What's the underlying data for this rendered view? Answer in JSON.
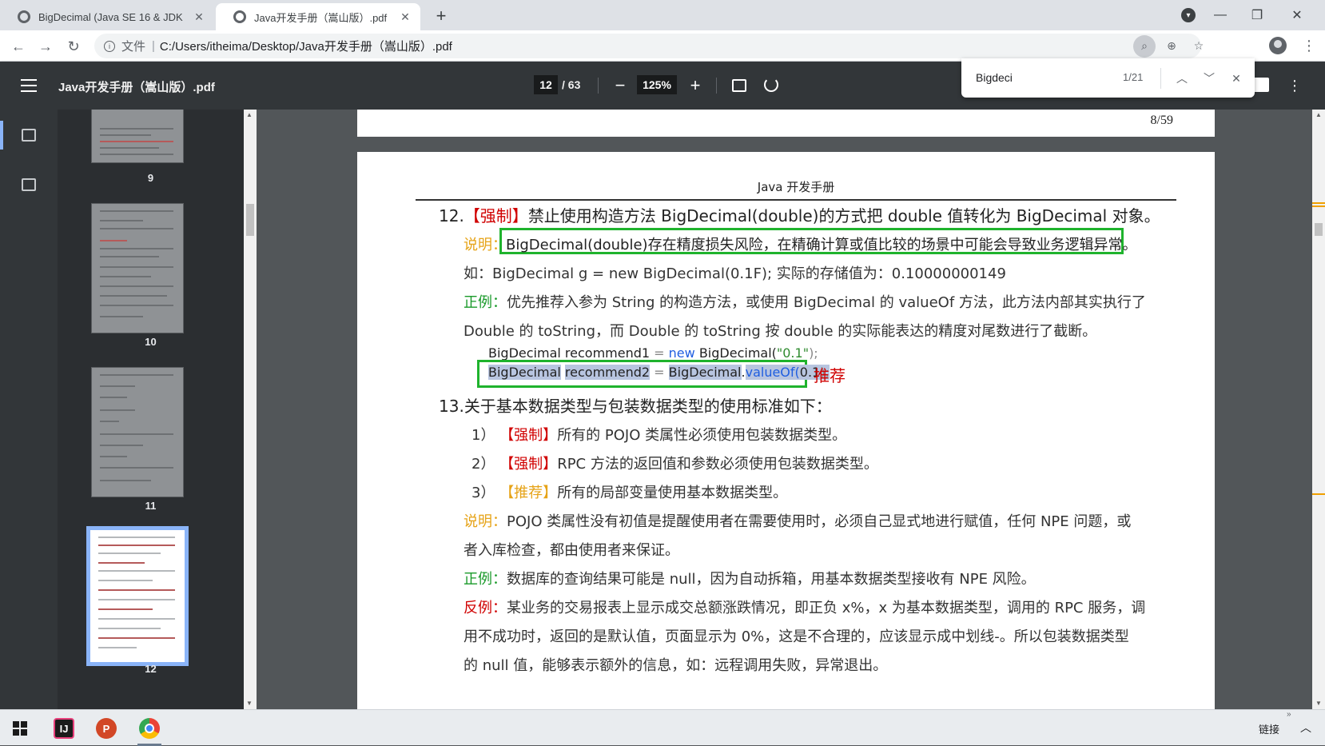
{
  "browser": {
    "tabs": [
      {
        "title": "BigDecimal (Java SE 16 & JDK",
        "active": false
      },
      {
        "title": "Java开发手册（嵩山版）.pdf",
        "active": true
      }
    ],
    "address": {
      "scheme_label": "文件",
      "separator": "|",
      "url": "C:/Users/itheima/Desktop/Java开发手册（嵩山版）.pdf"
    }
  },
  "pdf": {
    "title": "Java开发手册（嵩山版）.pdf",
    "current_page": "12",
    "total_pages": "/ 63",
    "zoom": "125%"
  },
  "find": {
    "query": "Bigdeci",
    "count": "1/21"
  },
  "sidebar": {
    "thumbnails": [
      {
        "label": "9"
      },
      {
        "label": "10"
      },
      {
        "label": "11"
      },
      {
        "label": "12",
        "selected": true
      }
    ]
  },
  "document": {
    "prev_page_number": "8/59",
    "header": "Java 开发手册",
    "item12": {
      "num": "12.",
      "tag": "【强制】",
      "text": "禁止使用构造方法 BigDecimal(double)的方式把 double 值转化为 BigDecimal 对象。",
      "explain_label": "说明：",
      "explain": "BigDecimal(double)存在精度损失风险，在精确计算或值比较的场景中可能会导致业务逻辑异常。",
      "example": "如：BigDecimal g = new BigDecimal(0.1F); 实际的存储值为：0.10000000149",
      "positive_label": "正例：",
      "positive_1": "优先推荐入参为 String 的构造方法，或使用 BigDecimal 的 valueOf 方法，此方法内部其实执行了",
      "positive_2": "Double 的 toString，而 Double 的 toString 按 double 的实际能表达的精度对尾数进行了截断。",
      "code1": {
        "type": "BigDecimal recommend1",
        "eq": "=",
        "kw": "new",
        "ctor": "BigDecimal(",
        "arg": "\"0.1\"",
        "end": ");"
      },
      "code2": {
        "type": "BigDecimal",
        "var": "recommend2",
        "eq": "=",
        "cls": "BigDecimal",
        "dot": ".",
        "method": "valueOf(",
        "arg": "0.1",
        "end": ");"
      },
      "recommend_note": "推荐"
    },
    "item13": {
      "num": "13.",
      "text": "关于基本数据类型与包装数据类型的使用标准如下：",
      "rules": [
        {
          "idx": "1）",
          "tag": "【强制】",
          "text": "所有的 POJO 类属性必须使用包装数据类型。"
        },
        {
          "idx": "2）",
          "tag": "【强制】",
          "text": "RPC 方法的返回值和参数必须使用包装数据类型。"
        },
        {
          "idx": "3）",
          "tag": "【推荐】",
          "text": "所有的局部变量使用基本数据类型。"
        }
      ],
      "explain_label": "说明：",
      "explain_1": "POJO 类属性没有初值是提醒使用者在需要使用时，必须自己显式地进行赋值，任何 NPE 问题，或",
      "explain_2": "者入库检查，都由使用者来保证。",
      "positive_label": "正例：",
      "positive": "数据库的查询结果可能是 null，因为自动拆箱，用基本数据类型接收有 NPE 风险。",
      "negative_label": "反例：",
      "negative_1": "某业务的交易报表上显示成交总额涨跌情况，即正负 x%，x 为基本数据类型，调用的 RPC 服务，调",
      "negative_2": "用不成功时，返回的是默认值，页面显示为 0%，这是不合理的，应该显示成中划线-。所以包装数据类型",
      "negative_3": "的 null 值，能够表示额外的信息，如：远程调用失败，异常退出。"
    }
  },
  "taskbar": {
    "tray_label": "链接"
  },
  "colors": {
    "pdf_toolbar": "#323639",
    "find_highlight": "#b8c5e0",
    "green_box": "#1fb32d",
    "tag_red": "#d00000",
    "tag_yellow": "#e6a317",
    "label_green": "#1a9a2a"
  }
}
